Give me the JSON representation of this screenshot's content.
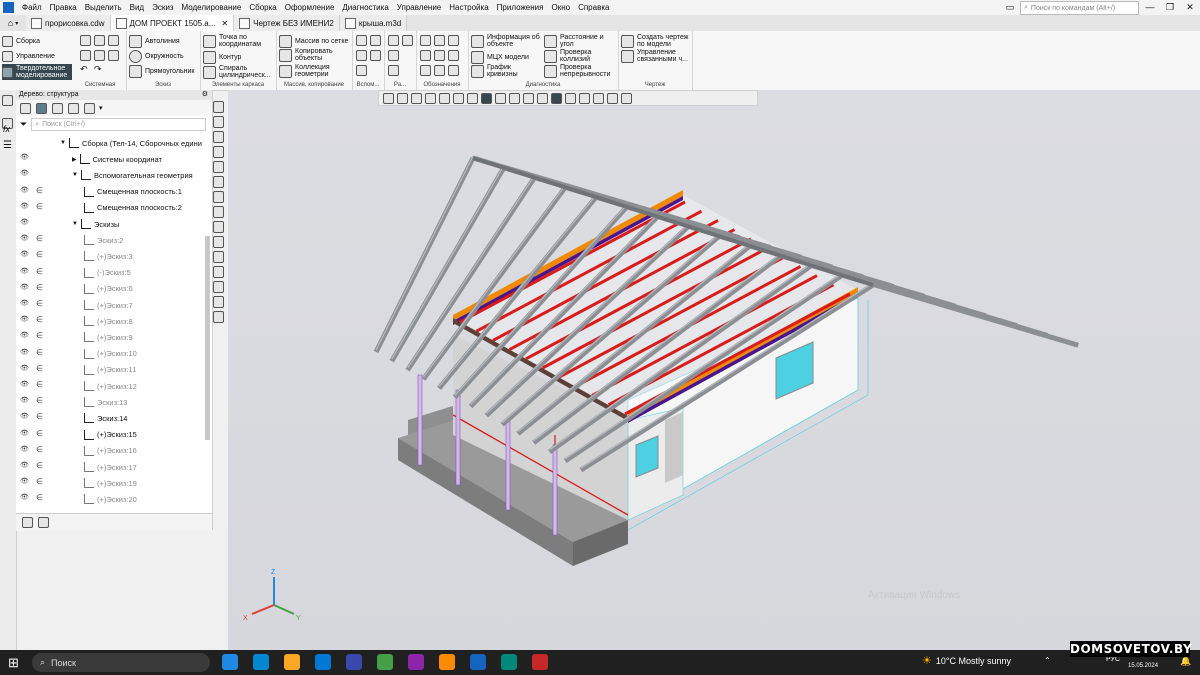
{
  "menu": {
    "items": [
      "Файл",
      "Правка",
      "Выделить",
      "Вид",
      "Эскиз",
      "Моделирование",
      "Сборка",
      "Оформление",
      "Диагностика",
      "Управление",
      "Настройка",
      "Приложения",
      "Окно",
      "Справка"
    ],
    "search_placeholder": "Поиск по командам (Alt+/)"
  },
  "tabs": [
    {
      "label": "прорисовка.cdw",
      "active": false
    },
    {
      "label": "ДОМ ПРОЕКТ 1505.a...",
      "active": true
    },
    {
      "label": "Чертеж БЕЗ ИМЕНИ2",
      "active": false
    },
    {
      "label": "крыша.m3d",
      "active": false
    }
  ],
  "ribbon": {
    "modes": [
      "Сборка",
      "Управление",
      "Твердотельное моделирование"
    ],
    "system_label": "Системная",
    "sketch": {
      "label": "Эскиз",
      "items": [
        "Автолиния",
        "Окружность",
        "Прямоугольник"
      ]
    },
    "frame": {
      "label": "Элементы каркаса",
      "items": [
        "Точка по координатам",
        "Контур",
        "Спираль цилиндрическ..."
      ]
    },
    "array": {
      "label": "Массив, копирование",
      "items": [
        "Массив по сетке",
        "Копировать объекты",
        "Коллекция геометрии"
      ]
    },
    "aux_label": "Вспом...",
    "ra_label": "Ра...",
    "notation_label": "Обозначения",
    "diag": {
      "label": "Диагностика",
      "items": [
        "Информация об объекте",
        "МЦХ модели",
        "График кривизны",
        "Расстояние и угол",
        "Проверка коллизий",
        "Проверка непрерывности"
      ]
    },
    "drawing": {
      "label": "Чертеж",
      "items": [
        "Создать чертеж по модели",
        "Управление связанными ч..."
      ]
    }
  },
  "tree": {
    "title": "Дерево: структура",
    "search_placeholder": "Поиск (Ctrl+/)",
    "nodes": [
      {
        "label": "Сборка (Тел-14, Сборочных едини",
        "indent": 0,
        "expand": "▼",
        "dim": false,
        "eye": false
      },
      {
        "label": "Системы координат",
        "indent": 1,
        "expand": "▶",
        "dim": false,
        "eye": true
      },
      {
        "label": "Вспомогательная геометрия",
        "indent": 1,
        "expand": "▼",
        "dim": false,
        "eye": true
      },
      {
        "label": "Смещенная плоскость:1",
        "indent": 2,
        "expand": "",
        "dim": false,
        "eye": true
      },
      {
        "label": "Смещенная плоскость:2",
        "indent": 2,
        "expand": "",
        "dim": false,
        "eye": true
      },
      {
        "label": "Эскизы",
        "indent": 1,
        "expand": "▼",
        "dim": false,
        "eye": true
      },
      {
        "label": "Эскиз:2",
        "indent": 2,
        "expand": "",
        "dim": true,
        "eye": true
      },
      {
        "label": "(+)Эскиз:3",
        "indent": 2,
        "expand": "",
        "dim": true,
        "eye": true
      },
      {
        "label": "(-)Эскиз:5",
        "indent": 2,
        "expand": "",
        "dim": true,
        "eye": true
      },
      {
        "label": "(+)Эскиз:6",
        "indent": 2,
        "expand": "",
        "dim": true,
        "eye": true
      },
      {
        "label": "(+)Эскиз:7",
        "indent": 2,
        "expand": "",
        "dim": true,
        "eye": true
      },
      {
        "label": "(+)Эскиз:8",
        "indent": 2,
        "expand": "",
        "dim": true,
        "eye": true
      },
      {
        "label": "(+)Эскиз:9",
        "indent": 2,
        "expand": "",
        "dim": true,
        "eye": true
      },
      {
        "label": "(+)Эскиз:10",
        "indent": 2,
        "expand": "",
        "dim": true,
        "eye": true
      },
      {
        "label": "(+)Эскиз:11",
        "indent": 2,
        "expand": "",
        "dim": true,
        "eye": true
      },
      {
        "label": "(+)Эскиз:12",
        "indent": 2,
        "expand": "",
        "dim": true,
        "eye": true
      },
      {
        "label": "Эскиз:13",
        "indent": 2,
        "expand": "",
        "dim": true,
        "eye": true
      },
      {
        "label": "Эскиз:14",
        "indent": 2,
        "expand": "",
        "dim": false,
        "eye": true
      },
      {
        "label": "(+)Эскиз:15",
        "indent": 2,
        "expand": "",
        "dim": false,
        "eye": true
      },
      {
        "label": "(+)Эскиз:16",
        "indent": 2,
        "expand": "",
        "dim": true,
        "eye": true
      },
      {
        "label": "(+)Эскиз:17",
        "indent": 2,
        "expand": "",
        "dim": true,
        "eye": true
      },
      {
        "label": "(+)Эскиз:19",
        "indent": 2,
        "expand": "",
        "dim": true,
        "eye": true
      },
      {
        "label": "(+)Эскиз:20",
        "indent": 2,
        "expand": "",
        "dim": true,
        "eye": true
      }
    ]
  },
  "viewport": {
    "axis_labels": {
      "x": "X",
      "y": "Y",
      "z": "Z"
    },
    "watermark": "Активация Windows"
  },
  "taskbar": {
    "search_label": "Поиск",
    "weather": "10°C  Mostly sunny",
    "lang": "РУС",
    "date": "15.05.2024"
  },
  "watermark_site": "DOMSOVETOV.BY",
  "colors": {
    "accent": "#1565c0",
    "rafter": "#8b8e93",
    "red_beam": "#d81b1b",
    "orange_beam": "#f08a00",
    "purple_beam": "#4a148c",
    "wall": "#f4f4f4",
    "window": "#4dd0e1"
  }
}
